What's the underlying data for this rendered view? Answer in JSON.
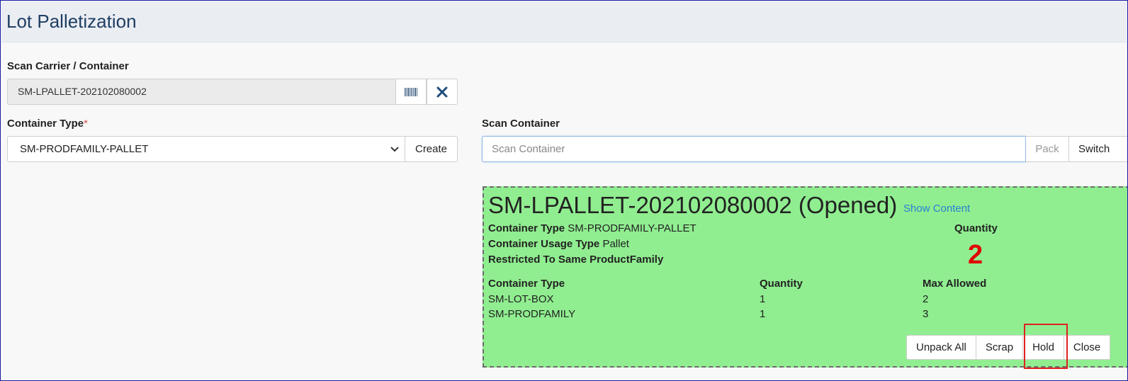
{
  "header": {
    "title": "Lot Palletization"
  },
  "carrier": {
    "label": "Scan Carrier / Container",
    "value": "SM-LPALLET-202102080002",
    "barcode_icon": "barcode-icon",
    "clear_icon": "close-icon"
  },
  "container_type": {
    "label": "Container Type",
    "required_mark": "*",
    "selected": "SM-PRODFAMILY-PALLET",
    "create_label": "Create"
  },
  "scan_container": {
    "label": "Scan Container",
    "placeholder": "Scan Container",
    "pack_label": "Pack",
    "switch_label": "Switch"
  },
  "panel": {
    "title": "SM-LPALLET-202102080002 (Opened)",
    "show_content": "Show Content",
    "container_type_label": "Container Type",
    "container_type_value": "SM-PRODFAMILY-PALLET",
    "usage_type_label": "Container Usage Type",
    "usage_type_value": "Pallet",
    "restriction": "Restricted To Same ProductFamily",
    "quantity_label": "Quantity",
    "quantity_value": "2",
    "background_color": "#90ee90",
    "table": {
      "headers": [
        "Container Type",
        "Quantity",
        "Max Allowed"
      ],
      "rows": [
        [
          "SM-LOT-BOX",
          "1",
          "2"
        ],
        [
          "SM-PRODFAMILY",
          "1",
          "3"
        ]
      ]
    },
    "actions": {
      "unpack_all": "Unpack All",
      "scrap": "Scrap",
      "hold": "Hold",
      "close": "Close"
    }
  },
  "colors": {
    "title_blue": "#1f3e63",
    "link_blue": "#2a7fd4",
    "quantity_red": "#e00000",
    "highlight_red": "#e02020"
  }
}
